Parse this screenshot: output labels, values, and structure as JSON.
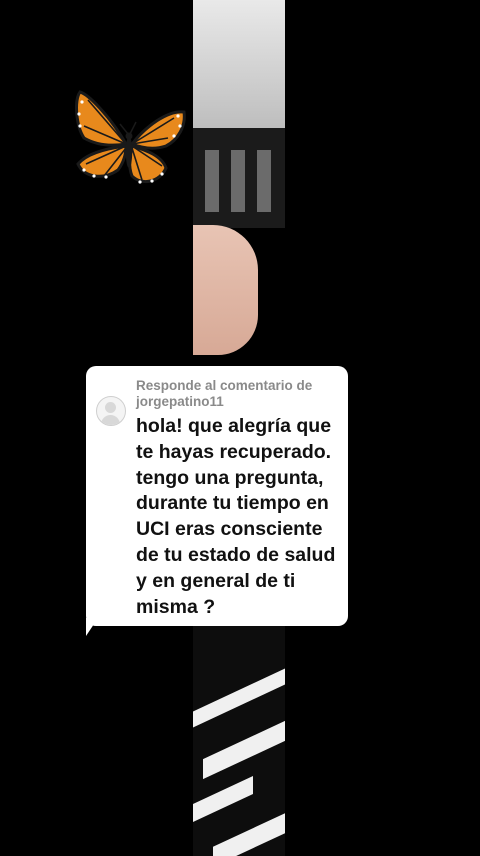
{
  "reply_card": {
    "label_prefix": "Responde al comentario de",
    "username": "jorgepatino11",
    "comment": "hola! que alegría que te hayas recuperado. tengo una pregunta, durante tu tiempo en UCI eras consciente de tu estado de salud y en general de ti misma ?"
  },
  "decor": {
    "sticker": "monarch-butterfly-icon"
  },
  "colors": {
    "background": "#000000",
    "card": "#ffffff",
    "label": "#8a8a8a",
    "text": "#111111"
  }
}
